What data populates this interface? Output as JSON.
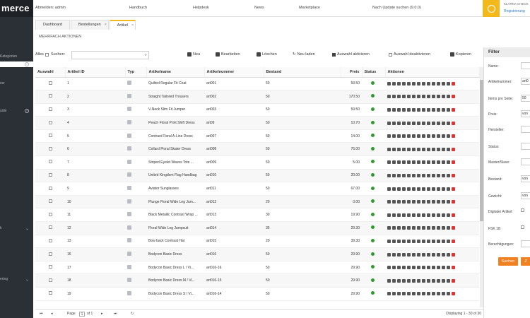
{
  "brand": {
    "label": "merce"
  },
  "sidebar": {
    "items": [
      {
        "label": "Kategorien"
      },
      {
        "label": "ew"
      },
      {
        "label": "uide"
      },
      {
        "label": "k"
      },
      {
        "label": "ering"
      }
    ]
  },
  "topbar": {
    "logout": "Abmelden: admin",
    "handbuch": "Handbuch",
    "helpdesk": "Helpdesk",
    "news": "News",
    "marketplace": "Marketplace",
    "update": "Nach Update suchen (9.0.0)",
    "user": "KLARNA CHECK",
    "register": "Registrierung"
  },
  "tabs": [
    {
      "label": "Dashboard"
    },
    {
      "label": "Bestellungen"
    },
    {
      "label": "Artikel"
    }
  ],
  "section": {
    "title": "MEHRFACH AKTIONEN"
  },
  "toolbar": {
    "alle": "Alles",
    "suchen": "Suchen:",
    "neu": "Neu",
    "bearbeiten": "Bearbeiten",
    "loeschen": "Löschen",
    "neu_laden": "Neu laden",
    "auswahl_aktivieren": "Auswahl aktivieren",
    "auswahl_deaktivieren": "Auswahl deaktivieren",
    "kopieren": "Kopieren"
  },
  "table": {
    "headers": {
      "auswahl": "Auswahl",
      "id": "Artikel ID",
      "typ": "Typ",
      "name": "Artikelname",
      "nummer": "Artikelnummer",
      "bestand": "Bestand",
      "preis": "Preis",
      "status": "Status",
      "aktionen": "Aktionen"
    },
    "rows": [
      {
        "id": "1",
        "name": "Quilted Regular Fit Coat",
        "nummer": "art001",
        "bestand": "50",
        "preis": "59.50"
      },
      {
        "id": "2",
        "name": "Straight Tailored Trousers",
        "nummer": "art002",
        "bestand": "50",
        "preis": "170.50"
      },
      {
        "id": "3",
        "name": "V-Neck Slim Fit Jumper",
        "nummer": "art003",
        "bestand": "50",
        "preis": "59.50"
      },
      {
        "id": "4",
        "name": "Peach Floral Print Shift Dress",
        "nummer": "art09",
        "bestand": "50",
        "preis": "10.70"
      },
      {
        "id": "5",
        "name": "Contrast Floral A-Line Dress",
        "nummer": "art007",
        "bestand": "50",
        "preis": "14.00"
      },
      {
        "id": "6",
        "name": "Collard Floral Skater Dress",
        "nummer": "art008",
        "bestand": "50",
        "preis": "76.00"
      },
      {
        "id": "7",
        "name": "Striped Eyelet Waves Tote ...",
        "nummer": "art009",
        "bestand": "50",
        "preis": "5.00"
      },
      {
        "id": "8",
        "name": "United Kingdom Flag Handbag",
        "nummer": "art010",
        "bestand": "50",
        "preis": "20.00"
      },
      {
        "id": "9",
        "name": "Aviator Sunglasses",
        "nummer": "art011",
        "bestand": "50",
        "preis": "67.00"
      },
      {
        "id": "10",
        "name": "Plunge Floral Wide Leg Jum...",
        "nummer": "art012",
        "bestand": "20",
        "preis": "0.00"
      },
      {
        "id": "11",
        "name": "Black Metallic Contrast Wrap ...",
        "nummer": "art013",
        "bestand": "30",
        "preis": "19.90"
      },
      {
        "id": "12",
        "name": "Floral Wide Leg Jumpsuit",
        "nummer": "art014",
        "bestand": "35",
        "preis": "29.30"
      },
      {
        "id": "13",
        "name": "Bow back Contrast Hat",
        "nummer": "art015",
        "bestand": "20",
        "preis": "39.30"
      },
      {
        "id": "16",
        "name": "Bodycon Basic Dress",
        "nummer": "art016",
        "bestand": "50",
        "preis": "29.90"
      },
      {
        "id": "17",
        "name": "Bodycon Basic Dress L / Vi...",
        "nummer": "art016-16",
        "bestand": "50",
        "preis": "29.90"
      },
      {
        "id": "18",
        "name": "Bodycon Basic Dress M / Vi...",
        "nummer": "art016-15",
        "bestand": "50",
        "preis": "29.90"
      },
      {
        "id": "19",
        "name": "Bodycon Basic Dress S / Vi...",
        "nummer": "art016-14",
        "bestand": "50",
        "preis": "29.90"
      }
    ]
  },
  "pager": {
    "page_label": "Page",
    "page_value": "1",
    "of_label": "of 1",
    "displaying": "Displaying 1 - 30 of 30"
  },
  "filter": {
    "title": "Filter",
    "name": "Name:",
    "artikelnummer": "Artikelnummer:",
    "artikelnummer_value": "art0",
    "items": "Items pro Seite:",
    "items_value": "50",
    "preis": "Preis:",
    "von": "von",
    "hersteller": "Hersteller:",
    "status": "Status:",
    "masterslave": "Master/Slave:",
    "bestand": "Bestand:",
    "gewicht": "Gewicht:",
    "digital": "Digitaler Artikel:",
    "fsk": "FSK 18:",
    "berecht": "Berechtigungen:",
    "suchen": "Suchen",
    "reset": "Z"
  },
  "colors": {
    "accent": "#f3b81c",
    "button": "#f08020",
    "status": "#2f9a2f",
    "sidebar": "#2b2f36"
  }
}
